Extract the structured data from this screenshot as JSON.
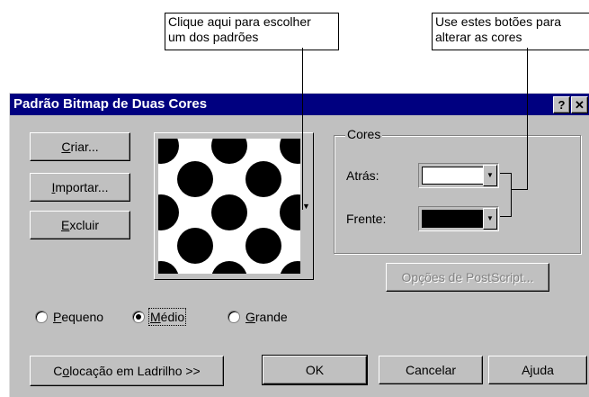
{
  "callouts": {
    "patterns": {
      "line1": "Clique aqui para escolher",
      "line2": "um dos padrões"
    },
    "colors": {
      "line1": "Use estes botões para",
      "line2": "alterar as cores"
    }
  },
  "dialog": {
    "title": "Padrão Bitmap de Duas Cores",
    "help_glyph": "?",
    "close_glyph": "✕"
  },
  "buttons": {
    "create": {
      "pre": "",
      "key": "C",
      "post": "riar..."
    },
    "import": {
      "pre": "",
      "key": "I",
      "post": "mportar..."
    },
    "delete": {
      "pre": "",
      "key": "E",
      "post": "xcluir"
    },
    "postscript": "Opções de PostScript...",
    "tiling": {
      "pre": "C",
      "key": "o",
      "post": "locação em Ladrilho >>"
    },
    "ok": "OK",
    "cancel": "Cancelar",
    "help": "Ajuda"
  },
  "colors_group": {
    "title": "Cores",
    "back_label": "Atrás:",
    "front_label": "Frente:",
    "back_color": "#ffffff",
    "front_color": "#000000"
  },
  "size_options": [
    {
      "pre": "",
      "key": "P",
      "post": "equeno",
      "selected": false
    },
    {
      "pre": "",
      "key": "M",
      "post": "édio",
      "selected": true
    },
    {
      "pre": "",
      "key": "G",
      "post": "rande",
      "selected": false
    }
  ],
  "icons": {
    "dropdown": "triangle-down-icon",
    "pattern": "dots-pattern-icon"
  }
}
